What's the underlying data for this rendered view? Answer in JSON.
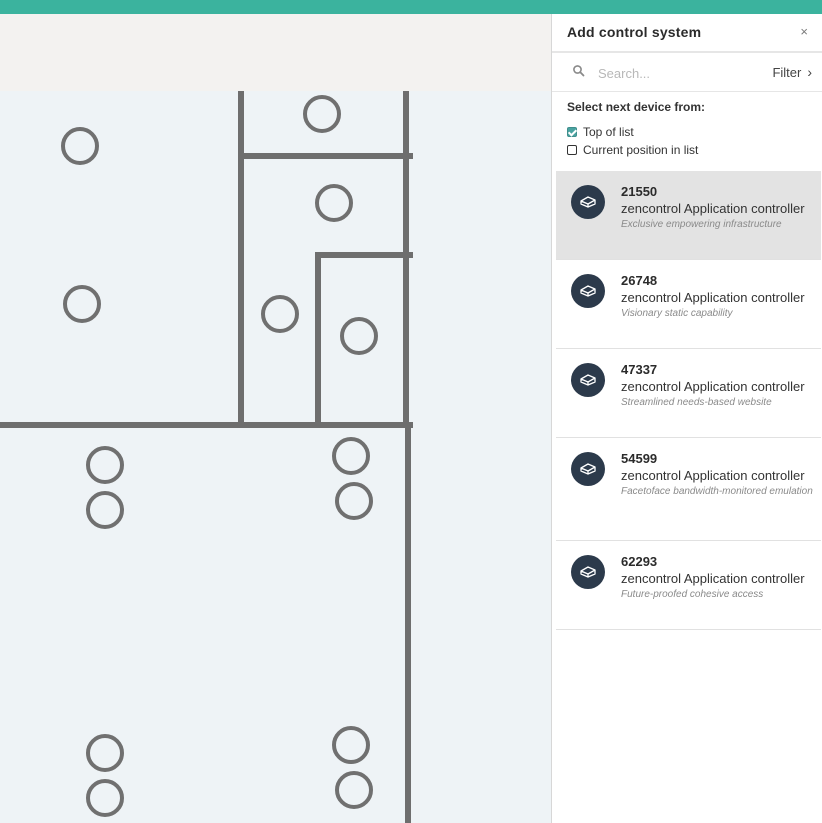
{
  "panel": {
    "title": "Add control system",
    "close_label": "×",
    "search_placeholder": "Search...",
    "search_value": "",
    "filter_label": "Filter",
    "filter_chevron": "›",
    "select_title": "Select next device from:",
    "options": [
      {
        "label": "Top of list",
        "checked": true
      },
      {
        "label": "Current position in list",
        "checked": false
      }
    ]
  },
  "devices": [
    {
      "id": "21550",
      "name": "zencontrol Application controller",
      "desc": "Exclusive empowering infrastructure",
      "selected": true,
      "icon": "controller-icon"
    },
    {
      "id": "26748",
      "name": "zencontrol Application controller",
      "desc": "Visionary static capability",
      "selected": false,
      "icon": "controller-icon"
    },
    {
      "id": "47337",
      "name": "zencontrol Application controller",
      "desc": "Streamlined needs-based website",
      "selected": false,
      "icon": "controller-icon"
    },
    {
      "id": "54599",
      "name": "zencontrol Application controller",
      "desc": "Facetoface bandwidth-monitored emulation",
      "selected": false,
      "icon": "controller-icon"
    },
    {
      "id": "62293",
      "name": "zencontrol Application controller",
      "desc": "Future-proofed cohesive access",
      "selected": false,
      "icon": "controller-icon"
    }
  ],
  "colors": {
    "accent": "#3bb39e",
    "icon_bg": "#2c3a4b",
    "wall": "#6e6e6e",
    "selected_row": "#e3e3e3"
  }
}
